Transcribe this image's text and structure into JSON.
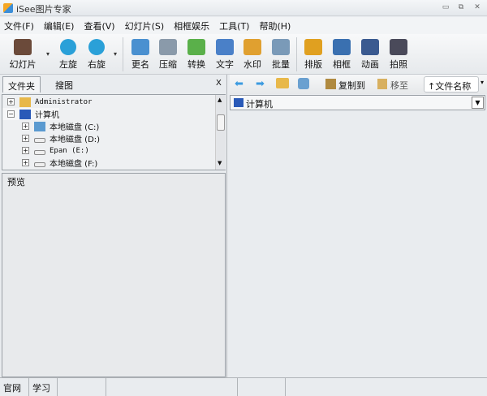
{
  "window": {
    "title": "iSee图片专家",
    "minimize": "▭",
    "restore": "⧉",
    "close": "✕"
  },
  "menu": [
    "文件(F)",
    "编辑(E)",
    "查看(V)",
    "幻灯片(S)",
    "相框娱乐",
    "工具(T)",
    "帮助(H)"
  ],
  "toolbar": [
    {
      "label": "幻灯片",
      "icon": "film-reel-icon",
      "color": "#6b4a3a"
    },
    {
      "label": "左旋",
      "icon": "rotate-left-icon",
      "color": "#2aa0d8"
    },
    {
      "label": "右旋",
      "icon": "rotate-right-icon",
      "color": "#2aa0d8"
    },
    {
      "label": "更名",
      "icon": "rename-icon",
      "color": "#4a90d0"
    },
    {
      "label": "压缩",
      "icon": "compress-icon",
      "color": "#8a9aaa"
    },
    {
      "label": "转换",
      "icon": "convert-icon",
      "color": "#5ab04a"
    },
    {
      "label": "文字",
      "icon": "text-icon",
      "color": "#4a80c8"
    },
    {
      "label": "水印",
      "icon": "watermark-icon",
      "color": "#e0a030"
    },
    {
      "label": "批量",
      "icon": "batch-icon",
      "color": "#7a9ab8"
    },
    {
      "label": "排版",
      "icon": "layout-icon",
      "color": "#e0a020"
    },
    {
      "label": "相框",
      "icon": "photo-frame-icon",
      "color": "#3a70b0"
    },
    {
      "label": "动画",
      "icon": "animation-icon",
      "color": "#3a5a90"
    },
    {
      "label": "拍照",
      "icon": "camera-icon",
      "color": "#4a4a5a"
    }
  ],
  "left": {
    "tabs": [
      "文件夹",
      "搜图"
    ],
    "close": "X",
    "tree": [
      {
        "label": "Administrator",
        "expander": "+",
        "mono": true
      },
      {
        "label": "计算机",
        "expander": "−",
        "mono": false
      },
      {
        "label": "本地磁盘 (C:)",
        "expander": "+",
        "mono": false
      },
      {
        "label": "本地磁盘 (D:)",
        "expander": "+",
        "mono": false
      },
      {
        "label": "Epan (E:)",
        "expander": "+",
        "mono": true
      },
      {
        "label": "本地磁盘 (F:)",
        "expander": "+",
        "mono": false
      }
    ],
    "preview_label": "预览"
  },
  "right": {
    "copy_to": "复制到",
    "move_to": "移至",
    "sort": "↑文件名称",
    "path": "计算机"
  },
  "status": [
    "官网",
    "学习",
    "",
    "",
    "",
    ""
  ]
}
